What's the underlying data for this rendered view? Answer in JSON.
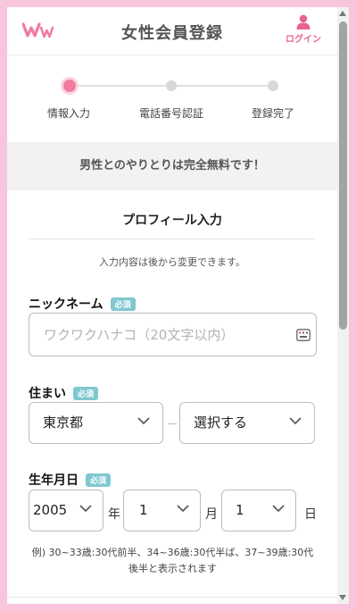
{
  "header": {
    "logo_text": "WW",
    "title": "女性会員登録",
    "login_label": "ログイン",
    "login_icon": "person-icon",
    "accent_color": "#e8648a"
  },
  "steps": [
    {
      "label": "情報入力",
      "active": true
    },
    {
      "label": "電話番号認証",
      "active": false
    },
    {
      "label": "登録完了",
      "active": false
    }
  ],
  "banner": {
    "text": "男性とのやりとりは完全無料です！"
  },
  "profile": {
    "section_title": "プロフィール入力",
    "note": "入力内容は後から変更できます。"
  },
  "nickname": {
    "label": "ニックネーム",
    "required": "必須",
    "value": "",
    "placeholder": "ワクワクハナコ（20文字以内）",
    "icon": "keyboard-icon"
  },
  "residence": {
    "label": "住まい",
    "required": "必須",
    "prefecture": "東京都",
    "city": "選択する"
  },
  "birthdate": {
    "label": "生年月日",
    "required": "必須",
    "year": "2005",
    "year_unit": "年",
    "month": "1",
    "month_unit": "月",
    "day": "1",
    "day_unit": "日",
    "example_line1": "例) 30~33歳:30代前半、34~36歳:30代半ば、37~39歳:30代",
    "example_line2": "後半と表示されます"
  }
}
